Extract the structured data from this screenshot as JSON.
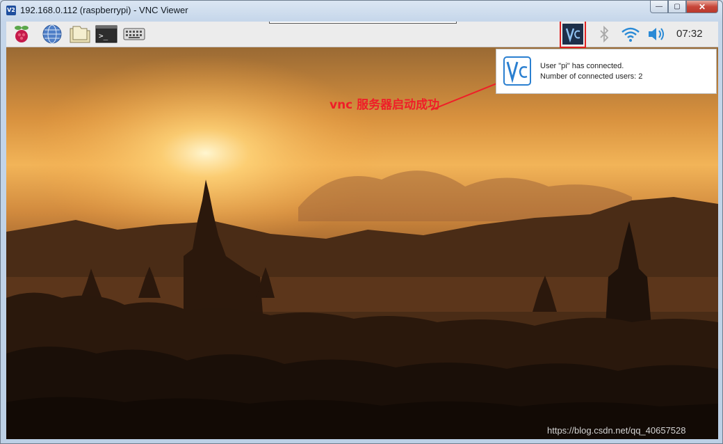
{
  "window": {
    "title": "192.168.0.112 (raspberrypi) - VNC Viewer",
    "controls": {
      "minimize": "—",
      "maximize": "▢",
      "close": "✕"
    }
  },
  "panel": {
    "launchers": [
      {
        "name": "raspberry-menu-icon"
      },
      {
        "name": "web-browser-icon"
      },
      {
        "name": "file-manager-icon"
      },
      {
        "name": "terminal-icon"
      },
      {
        "name": "keyboard-icon"
      }
    ],
    "tray": [
      "vnc-server-icon",
      "bluetooth-icon",
      "wifi-icon",
      "volume-icon"
    ],
    "clock": "07:32"
  },
  "notification": {
    "line1": "User \"pi\" has connected.",
    "line2": "Number of connected users: 2"
  },
  "annotation": {
    "text": "vnc 服务器启动成功",
    "color": "#ef1e28"
  },
  "watermark": "https://blog.csdn.net/qq_40657528",
  "colors": {
    "annotation": "#ef1e28",
    "panel": "#ececec",
    "highlight_box": "#e02020"
  }
}
